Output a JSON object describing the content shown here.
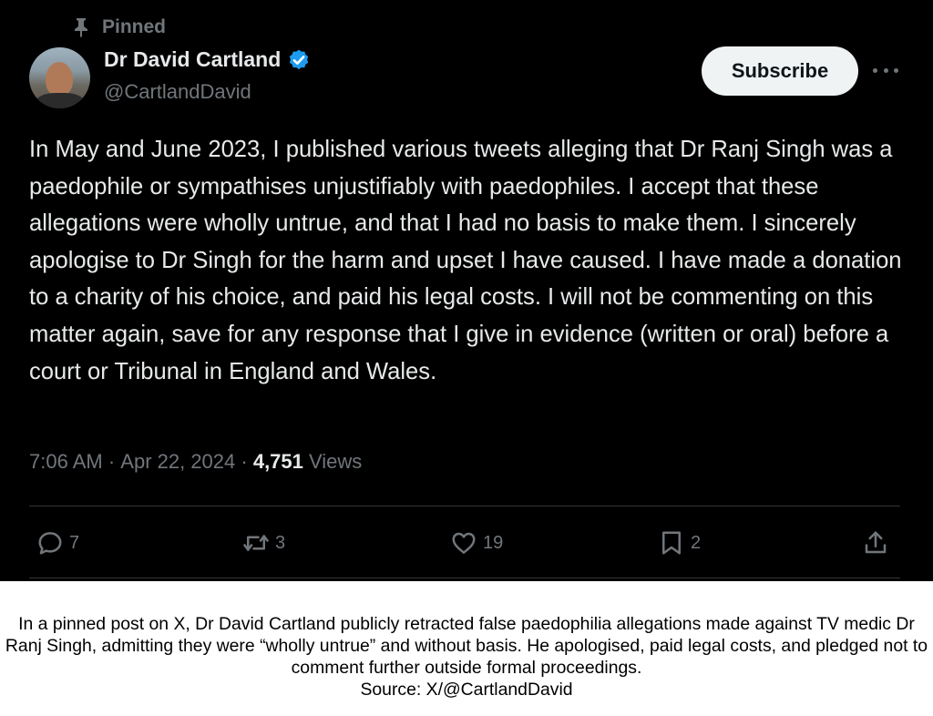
{
  "pinned_label": "Pinned",
  "author": {
    "name": "Dr David Cartland",
    "handle": "@CartlandDavid",
    "verified": true
  },
  "subscribe_label": "Subscribe",
  "tweet_text": "In May and June 2023, I published various tweets alleging that Dr Ranj Singh was a paedophile or sympathises unjustifiably with paedophiles. I accept that these allegations were wholly untrue, and that I had no basis to make them. I sincerely apologise to Dr Singh for the harm and upset I have caused. I have made a donation to a charity of his choice, and paid his legal costs. I will not be commenting on this matter again, save for any response that I give in evidence (written or oral) before a court or Tribunal in England and Wales.",
  "meta": {
    "time": "7:06 AM",
    "date": "Apr 22, 2024",
    "views_count": "4,751",
    "views_label": "Views"
  },
  "actions": {
    "replies": "7",
    "reposts": "3",
    "likes": "19",
    "bookmarks": "2"
  },
  "caption": {
    "text": "In a pinned post on X, Dr David Cartland publicly retracted false paedophilia allegations made against TV medic Dr Ranj Singh, admitting they were “wholly untrue” and without basis. He apologised, paid legal costs, and pledged not to comment further outside formal proceedings.",
    "source": "Source: X/@CartlandDavid"
  },
  "colors": {
    "background": "#000000",
    "text": "#e7e9ea",
    "muted": "#71767b",
    "verified": "#1d9bf0",
    "button": "#eff3f4"
  },
  "icons": [
    "pin-icon",
    "verified-badge-icon",
    "more-icon",
    "reply-icon",
    "repost-icon",
    "like-icon",
    "bookmark-icon",
    "share-icon"
  ]
}
